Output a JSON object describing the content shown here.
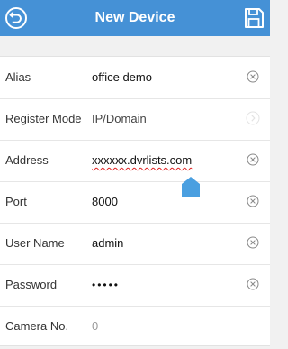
{
  "header": {
    "title": "New Device",
    "back_icon": "back-arrow-icon",
    "save_icon": "floppy-save-icon",
    "background": "#4591d6"
  },
  "form": {
    "alias": {
      "label": "Alias",
      "value": "office demo"
    },
    "register_mode": {
      "label": "Register Mode",
      "value": "IP/Domain"
    },
    "address": {
      "label": "Address",
      "value": "xxxxxx.dvrlists.com"
    },
    "port": {
      "label": "Port",
      "value": "8000"
    },
    "user_name": {
      "label": "User Name",
      "value": "admin"
    },
    "password": {
      "label": "Password",
      "value": "•••••"
    },
    "camera_no": {
      "label": "Camera No.",
      "value": "0"
    }
  },
  "colors": {
    "accent": "#4591d6",
    "page_background": "#f1f1f1",
    "spellcheck": "#e02020"
  }
}
